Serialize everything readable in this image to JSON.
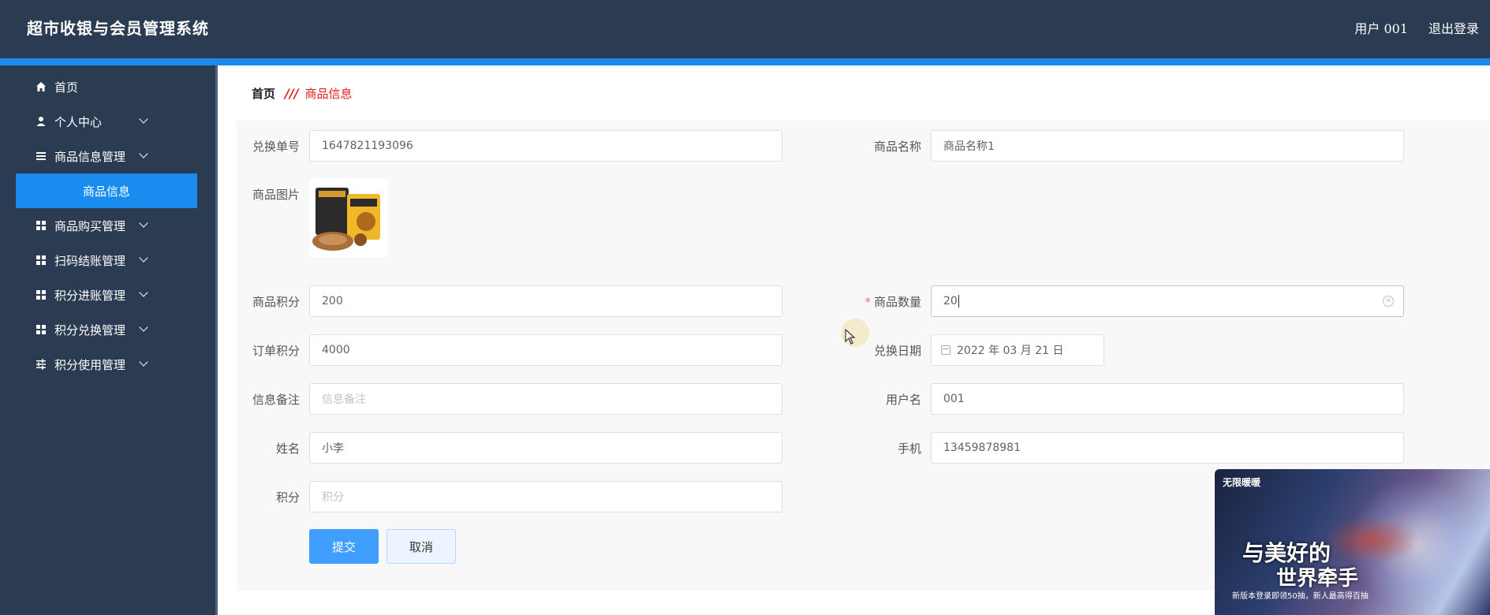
{
  "app": {
    "title": "超市收银与会员管理系统"
  },
  "header": {
    "user_label": "用户 001",
    "logout_label": "退出登录"
  },
  "sidebar": {
    "items": [
      {
        "label": "首页",
        "icon": "home-icon"
      },
      {
        "label": "个人中心",
        "icon": "user-icon"
      },
      {
        "label": "商品信息管理",
        "icon": "list-icon"
      },
      {
        "label": "商品购买管理",
        "icon": "grid-icon"
      },
      {
        "label": "扫码结账管理",
        "icon": "grid-icon"
      },
      {
        "label": "积分进账管理",
        "icon": "grid-icon"
      },
      {
        "label": "积分兑换管理",
        "icon": "grid-icon"
      },
      {
        "label": "积分使用管理",
        "icon": "sliders-icon"
      }
    ],
    "active_sub_item": "商品信息"
  },
  "breadcrumb": {
    "home": "首页",
    "separator": "///",
    "current": "商品信息"
  },
  "form": {
    "exchange_no": {
      "label": "兑换单号",
      "value": "1647821193096"
    },
    "product_name": {
      "label": "商品名称",
      "value": "商品名称1"
    },
    "product_image": {
      "label": "商品图片"
    },
    "product_points": {
      "label": "商品积分",
      "value": "200"
    },
    "product_quantity": {
      "label": "商品数量",
      "value": "20",
      "required_mark": "*"
    },
    "order_points": {
      "label": "订单积分",
      "value": "4000"
    },
    "exchange_date": {
      "label": "兑换日期",
      "value": "2022 年 03 月 21 日"
    },
    "remark": {
      "label": "信息备注",
      "value": "",
      "placeholder": "信息备注"
    },
    "username": {
      "label": "用户名",
      "value": "001"
    },
    "name": {
      "label": "姓名",
      "value": "小李"
    },
    "phone": {
      "label": "手机",
      "value": "13459878981"
    },
    "points": {
      "label": "积分",
      "value": "",
      "placeholder": "积分"
    },
    "submit_label": "提交",
    "cancel_label": "取消"
  },
  "ad": {
    "logo": "无限暖暖",
    "line1": "与美好的",
    "line2": "世界牵手",
    "sub": "新版本登录即领50抽，新人最高得百抽"
  },
  "colors": {
    "header_bg": "#2a3b52",
    "accent": "#1a8cf0",
    "primary_button": "#409eff",
    "breadcrumb_active": "#e0201b"
  }
}
